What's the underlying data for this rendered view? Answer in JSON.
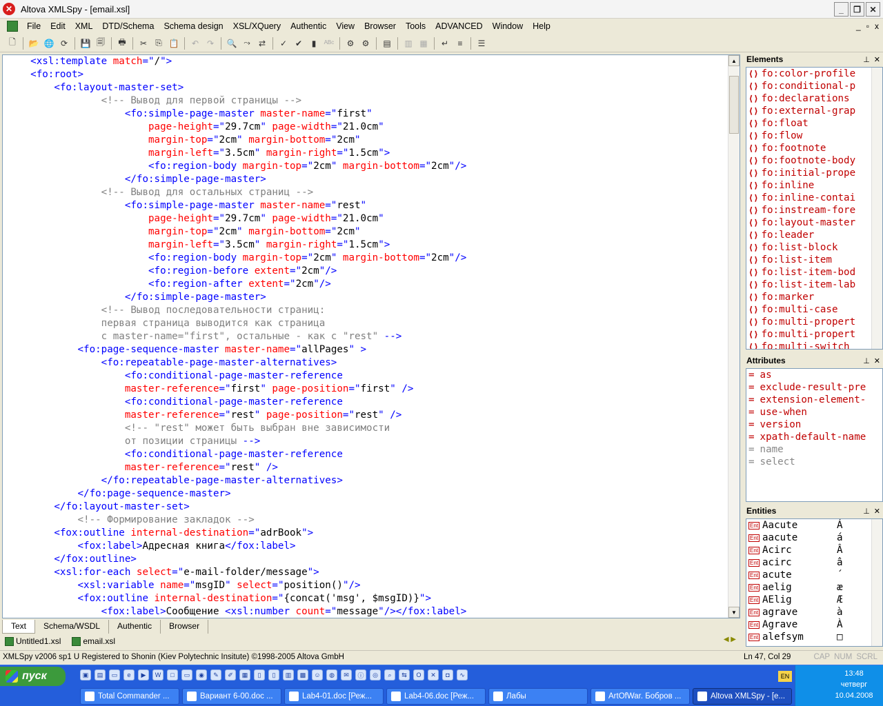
{
  "window": {
    "title": "Altova XMLSpy - [email.xsl]",
    "mdi_controls": [
      "_",
      "▫",
      "x"
    ],
    "controls": [
      "_",
      "❐",
      "✕"
    ]
  },
  "menu": [
    "File",
    "Edit",
    "XML",
    "DTD/Schema",
    "Schema design",
    "XSL/XQuery",
    "Authentic",
    "View",
    "Browser",
    "Tools",
    "ADVANCED",
    "Window",
    "Help"
  ],
  "editor": {
    "lines": [
      [
        [
          "t",
          "    <xsl:template "
        ],
        [
          "a",
          "match"
        ],
        [
          "t",
          "=\""
        ],
        [
          "v",
          "/"
        ],
        [
          "t",
          "\">"
        ]
      ],
      [
        [
          "t",
          "    <fo:root>"
        ]
      ],
      [
        [
          "t",
          "        <fo:layout-master-set>"
        ]
      ],
      [
        [
          "t",
          "                "
        ],
        [
          "c",
          "<!-- Вывод для первой страницы -->"
        ]
      ],
      [
        [
          "t",
          "                    <fo:simple-page-master "
        ],
        [
          "a",
          "master-name"
        ],
        [
          "t",
          "=\""
        ],
        [
          "v",
          "first"
        ],
        [
          "t",
          "\""
        ]
      ],
      [
        [
          "a",
          "                        page-height"
        ],
        [
          "t",
          "=\""
        ],
        [
          "v",
          "29.7cm"
        ],
        [
          "t",
          "\" "
        ],
        [
          "a",
          "page-width"
        ],
        [
          "t",
          "=\""
        ],
        [
          "v",
          "21.0cm"
        ],
        [
          "t",
          "\""
        ]
      ],
      [
        [
          "a",
          "                        margin-top"
        ],
        [
          "t",
          "=\""
        ],
        [
          "v",
          "2cm"
        ],
        [
          "t",
          "\" "
        ],
        [
          "a",
          "margin-bottom"
        ],
        [
          "t",
          "=\""
        ],
        [
          "v",
          "2cm"
        ],
        [
          "t",
          "\""
        ]
      ],
      [
        [
          "a",
          "                        margin-left"
        ],
        [
          "t",
          "=\""
        ],
        [
          "v",
          "3.5cm"
        ],
        [
          "t",
          "\" "
        ],
        [
          "a",
          "margin-right"
        ],
        [
          "t",
          "=\""
        ],
        [
          "v",
          "1.5cm"
        ],
        [
          "t",
          "\">"
        ]
      ],
      [
        [
          "t",
          "                        <fo:region-body "
        ],
        [
          "a",
          "margin-top"
        ],
        [
          "t",
          "=\""
        ],
        [
          "v",
          "2cm"
        ],
        [
          "t",
          "\" "
        ],
        [
          "a",
          "margin-bottom"
        ],
        [
          "t",
          "=\""
        ],
        [
          "v",
          "2cm"
        ],
        [
          "t",
          "\"/>"
        ]
      ],
      [
        [
          "t",
          "                    </fo:simple-page-master>"
        ]
      ],
      [
        [
          "t",
          "                "
        ],
        [
          "c",
          "<!-- Вывод для остальных страниц -->"
        ]
      ],
      [
        [
          "t",
          "                    <fo:simple-page-master "
        ],
        [
          "a",
          "master-name"
        ],
        [
          "t",
          "=\""
        ],
        [
          "v",
          "rest"
        ],
        [
          "t",
          "\""
        ]
      ],
      [
        [
          "a",
          "                        page-height"
        ],
        [
          "t",
          "=\""
        ],
        [
          "v",
          "29.7cm"
        ],
        [
          "t",
          "\" "
        ],
        [
          "a",
          "page-width"
        ],
        [
          "t",
          "=\""
        ],
        [
          "v",
          "21.0cm"
        ],
        [
          "t",
          "\""
        ]
      ],
      [
        [
          "a",
          "                        margin-top"
        ],
        [
          "t",
          "=\""
        ],
        [
          "v",
          "2cm"
        ],
        [
          "t",
          "\" "
        ],
        [
          "a",
          "margin-bottom"
        ],
        [
          "t",
          "=\""
        ],
        [
          "v",
          "2cm"
        ],
        [
          "t",
          "\""
        ]
      ],
      [
        [
          "a",
          "                        margin-left"
        ],
        [
          "t",
          "=\""
        ],
        [
          "v",
          "3.5cm"
        ],
        [
          "t",
          "\" "
        ],
        [
          "a",
          "margin-right"
        ],
        [
          "t",
          "=\""
        ],
        [
          "v",
          "1.5cm"
        ],
        [
          "t",
          "\">"
        ]
      ],
      [
        [
          "t",
          "                        <fo:region-body "
        ],
        [
          "a",
          "margin-top"
        ],
        [
          "t",
          "=\""
        ],
        [
          "v",
          "2cm"
        ],
        [
          "t",
          "\" "
        ],
        [
          "a",
          "margin-bottom"
        ],
        [
          "t",
          "=\""
        ],
        [
          "v",
          "2cm"
        ],
        [
          "t",
          "\"/>"
        ]
      ],
      [
        [
          "t",
          "                        <fo:region-before "
        ],
        [
          "a",
          "extent"
        ],
        [
          "t",
          "=\""
        ],
        [
          "v",
          "2cm"
        ],
        [
          "t",
          "\"/>"
        ]
      ],
      [
        [
          "t",
          "                        <fo:region-after "
        ],
        [
          "a",
          "extent"
        ],
        [
          "t",
          "=\""
        ],
        [
          "v",
          "2cm"
        ],
        [
          "t",
          "\"/>"
        ]
      ],
      [
        [
          "t",
          "                    </fo:simple-page-master>"
        ]
      ],
      [
        [
          "t",
          "                "
        ],
        [
          "c",
          "<!-- Вывод последовательности страниц:"
        ]
      ],
      [
        [
          "c",
          "                первая страница выводится как страница"
        ]
      ],
      [
        [
          "c",
          "                с master-name=\"first\", остальные - как с \"rest\" "
        ],
        [
          "t",
          "-->"
        ]
      ],
      [
        [
          "t",
          "            <fo:page-sequence-master "
        ],
        [
          "a",
          "master-name"
        ],
        [
          "t",
          "=\""
        ],
        [
          "v",
          "allPages"
        ],
        [
          "t",
          "\" >"
        ]
      ],
      [
        [
          "t",
          "                <fo:repeatable-page-master-alternatives>"
        ]
      ],
      [
        [
          "t",
          "                    <fo:conditional-page-master-reference"
        ]
      ],
      [
        [
          "a",
          "                    master-reference"
        ],
        [
          "t",
          "=\""
        ],
        [
          "v",
          "first"
        ],
        [
          "t",
          "\" "
        ],
        [
          "a",
          "page-position"
        ],
        [
          "t",
          "=\""
        ],
        [
          "v",
          "first"
        ],
        [
          "t",
          "\" />"
        ]
      ],
      [
        [
          "t",
          "                    <fo:conditional-page-master-reference"
        ]
      ],
      [
        [
          "a",
          "                    master-reference"
        ],
        [
          "t",
          "=\""
        ],
        [
          "v",
          "rest"
        ],
        [
          "t",
          "\" "
        ],
        [
          "a",
          "page-position"
        ],
        [
          "t",
          "=\""
        ],
        [
          "v",
          "rest"
        ],
        [
          "t",
          "\" />"
        ]
      ],
      [
        [
          "t",
          "                    "
        ],
        [
          "c",
          "<!-- \"rest\" может быть выбран вне зависимости"
        ]
      ],
      [
        [
          "c",
          "                    от позиции страницы "
        ],
        [
          "t",
          "-->"
        ]
      ],
      [
        [
          "t",
          "                    <fo:conditional-page-master-reference"
        ]
      ],
      [
        [
          "a",
          "                    master-reference"
        ],
        [
          "t",
          "=\""
        ],
        [
          "v",
          "rest"
        ],
        [
          "t",
          "\" />"
        ]
      ],
      [
        [
          "t",
          "                </fo:repeatable-page-master-alternatives>"
        ]
      ],
      [
        [
          "t",
          "            </fo:page-sequence-master>"
        ]
      ],
      [
        [
          "t",
          "        </fo:layout-master-set>"
        ]
      ],
      [
        [
          "t",
          "            "
        ],
        [
          "c",
          "<!-- Формирование закладок -->"
        ]
      ],
      [
        [
          "t",
          "        <fox:outline "
        ],
        [
          "a",
          "internal-destination"
        ],
        [
          "t",
          "=\""
        ],
        [
          "v",
          "adrBook"
        ],
        [
          "t",
          "\">"
        ]
      ],
      [
        [
          "t",
          "            <fox:label>"
        ],
        [
          "v",
          "Адресная книга"
        ],
        [
          "t",
          "</fox:label>"
        ]
      ],
      [
        [
          "t",
          "        </fox:outline>"
        ]
      ],
      [
        [
          "t",
          "        <xsl:for-each "
        ],
        [
          "a",
          "select"
        ],
        [
          "t",
          "=\""
        ],
        [
          "v",
          "e-mail-folder/message"
        ],
        [
          "t",
          "\">"
        ]
      ],
      [
        [
          "t",
          "            <xsl:variable "
        ],
        [
          "a",
          "name"
        ],
        [
          "t",
          "=\""
        ],
        [
          "v",
          "msgID"
        ],
        [
          "t",
          "\" "
        ],
        [
          "a",
          "select"
        ],
        [
          "t",
          "=\""
        ],
        [
          "v",
          "position()"
        ],
        [
          "t",
          "\"/>"
        ]
      ],
      [
        [
          "t",
          "            <fox:outline "
        ],
        [
          "a",
          "internal-destination"
        ],
        [
          "t",
          "=\""
        ],
        [
          "v",
          "{concat('msg', $msgID)}"
        ],
        [
          "t",
          "\">"
        ]
      ],
      [
        [
          "t",
          "                <fox:label>"
        ],
        [
          "v",
          "Сообщение "
        ],
        [
          "t",
          "<xsl:number "
        ],
        [
          "a",
          "count"
        ],
        [
          "t",
          "=\""
        ],
        [
          "v",
          "message"
        ],
        [
          "t",
          "\"/></fox:label>"
        ]
      ]
    ]
  },
  "editor_tabs": [
    "Text",
    "Schema/WSDL",
    "Authentic",
    "Browser"
  ],
  "doc_tabs": [
    "Untitled1.xsl",
    "email.xsl"
  ],
  "elements_panel": {
    "title": "Elements",
    "items": [
      "fo:color-profile",
      "fo:conditional-p",
      "fo:declarations",
      "fo:external-grap",
      "fo:float",
      "fo:flow",
      "fo:footnote",
      "fo:footnote-body",
      "fo:initial-prope",
      "fo:inline",
      "fo:inline-contai",
      "fo:instream-fore",
      "fo:layout-master",
      "fo:leader",
      "fo:list-block",
      "fo:list-item",
      "fo:list-item-bod",
      "fo:list-item-lab",
      "fo:marker",
      "fo:multi-case",
      "fo:multi-propert",
      "fo:multi-propert",
      "fo:multi-switch"
    ]
  },
  "attributes_panel": {
    "title": "Attributes",
    "items": [
      {
        "name": "as",
        "dim": false
      },
      {
        "name": "exclude-result-pre",
        "dim": false
      },
      {
        "name": "extension-element-",
        "dim": false
      },
      {
        "name": "use-when",
        "dim": false
      },
      {
        "name": "version",
        "dim": false
      },
      {
        "name": "xpath-default-name",
        "dim": false
      },
      {
        "name": "name",
        "dim": true
      },
      {
        "name": "select",
        "dim": true
      }
    ]
  },
  "entities_panel": {
    "title": "Entities",
    "items": [
      {
        "name": "Aacute",
        "char": "Á"
      },
      {
        "name": "aacute",
        "char": "á"
      },
      {
        "name": "Acirc",
        "char": "Â"
      },
      {
        "name": "acirc",
        "char": "â"
      },
      {
        "name": "acute",
        "char": "´"
      },
      {
        "name": "aelig",
        "char": "æ"
      },
      {
        "name": "AElig",
        "char": "Æ"
      },
      {
        "name": "agrave",
        "char": "à"
      },
      {
        "name": "Agrave",
        "char": "À"
      },
      {
        "name": "alefsym",
        "char": "□"
      }
    ]
  },
  "status": {
    "text": "XMLSpy v2006 sp1 U   Registered to Shonin (Kiev Polytechnic Insitute)  ©1998-2005 Altova GmbH",
    "position": "Ln 47, Col 29",
    "flags": [
      "CAP",
      "NUM",
      "SCRL"
    ]
  },
  "taskbar": {
    "start": "пуск",
    "tasks": [
      {
        "label": "Total Commander ...",
        "active": false
      },
      {
        "label": "Вариант 6-00.doc ...",
        "active": false
      },
      {
        "label": "Lab4-01.doc [Реж...",
        "active": false
      },
      {
        "label": "Lab4-06.doc [Реж...",
        "active": false
      },
      {
        "label": "Лабы",
        "active": false
      },
      {
        "label": "ArtOfWar. Бобров ...",
        "active": false
      },
      {
        "label": "Altova XMLSpy - [e...",
        "active": true
      }
    ],
    "lang": "EN",
    "time": "13:48",
    "day": "четверг",
    "date": "10.04.2008"
  }
}
